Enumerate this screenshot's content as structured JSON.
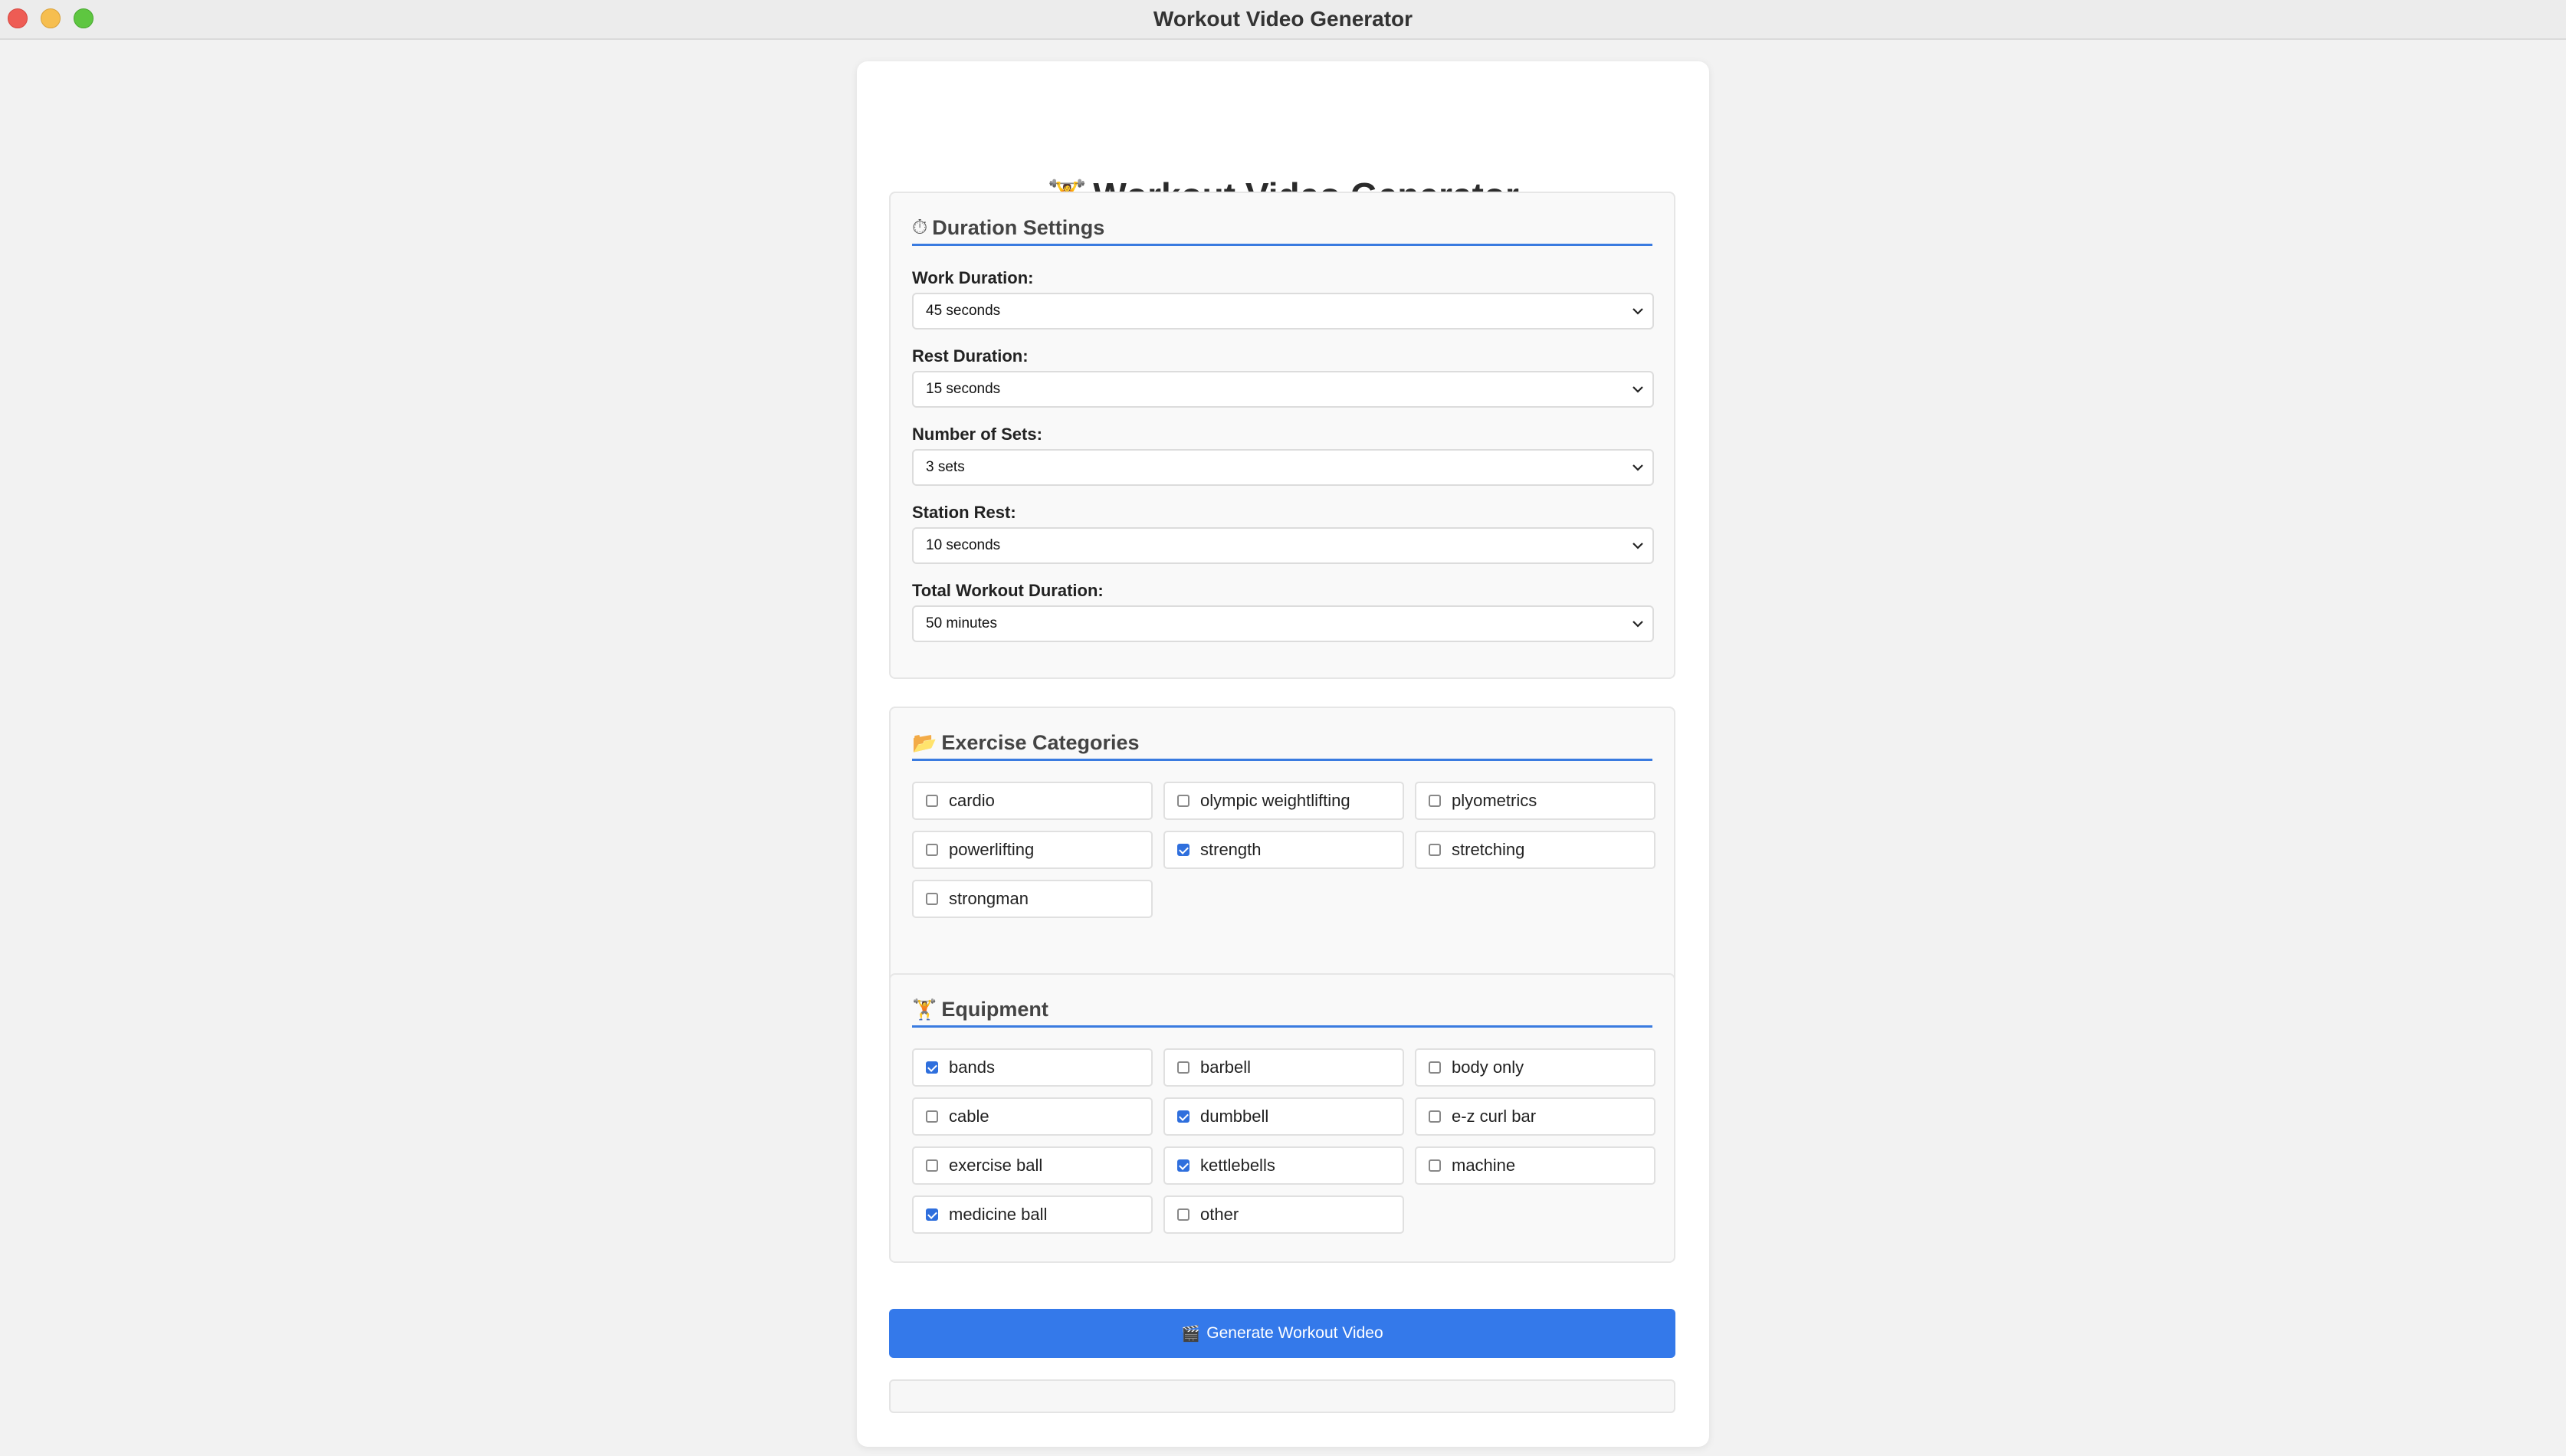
{
  "window": {
    "title": "Workout Video Generator"
  },
  "page": {
    "title_emoji": "🏋",
    "title": "Workout Video Generator"
  },
  "duration": {
    "icon": "⏱",
    "heading": "Duration Settings",
    "fields": [
      {
        "label": "Work Duration:",
        "value": "45 seconds"
      },
      {
        "label": "Rest Duration:",
        "value": "15 seconds"
      },
      {
        "label": "Number of Sets:",
        "value": "3 sets"
      },
      {
        "label": "Station Rest:",
        "value": "10 seconds"
      },
      {
        "label": "Total Workout Duration:",
        "value": "50 minutes"
      }
    ]
  },
  "categories": {
    "icon": "📂",
    "heading": "Exercise Categories",
    "options": [
      {
        "label": "cardio",
        "checked": false
      },
      {
        "label": "olympic weightlifting",
        "checked": false
      },
      {
        "label": "plyometrics",
        "checked": false
      },
      {
        "label": "powerlifting",
        "checked": false
      },
      {
        "label": "strength",
        "checked": true
      },
      {
        "label": "stretching",
        "checked": false
      },
      {
        "label": "strongman",
        "checked": false
      }
    ]
  },
  "equipment": {
    "icon": "🏋",
    "heading": "Equipment",
    "options": [
      {
        "label": "bands",
        "checked": true
      },
      {
        "label": "barbell",
        "checked": false
      },
      {
        "label": "body only",
        "checked": false
      },
      {
        "label": "cable",
        "checked": false
      },
      {
        "label": "dumbbell",
        "checked": true
      },
      {
        "label": "e-z curl bar",
        "checked": false
      },
      {
        "label": "exercise ball",
        "checked": false
      },
      {
        "label": "kettlebells",
        "checked": true
      },
      {
        "label": "machine",
        "checked": false
      },
      {
        "label": "medicine ball",
        "checked": true
      },
      {
        "label": "other",
        "checked": false
      }
    ]
  },
  "generate": {
    "icon": "🎬",
    "label": "Generate Workout Video"
  },
  "colors": {
    "accent": "#3479ea",
    "checkbox_on": "#2f6fdd"
  }
}
